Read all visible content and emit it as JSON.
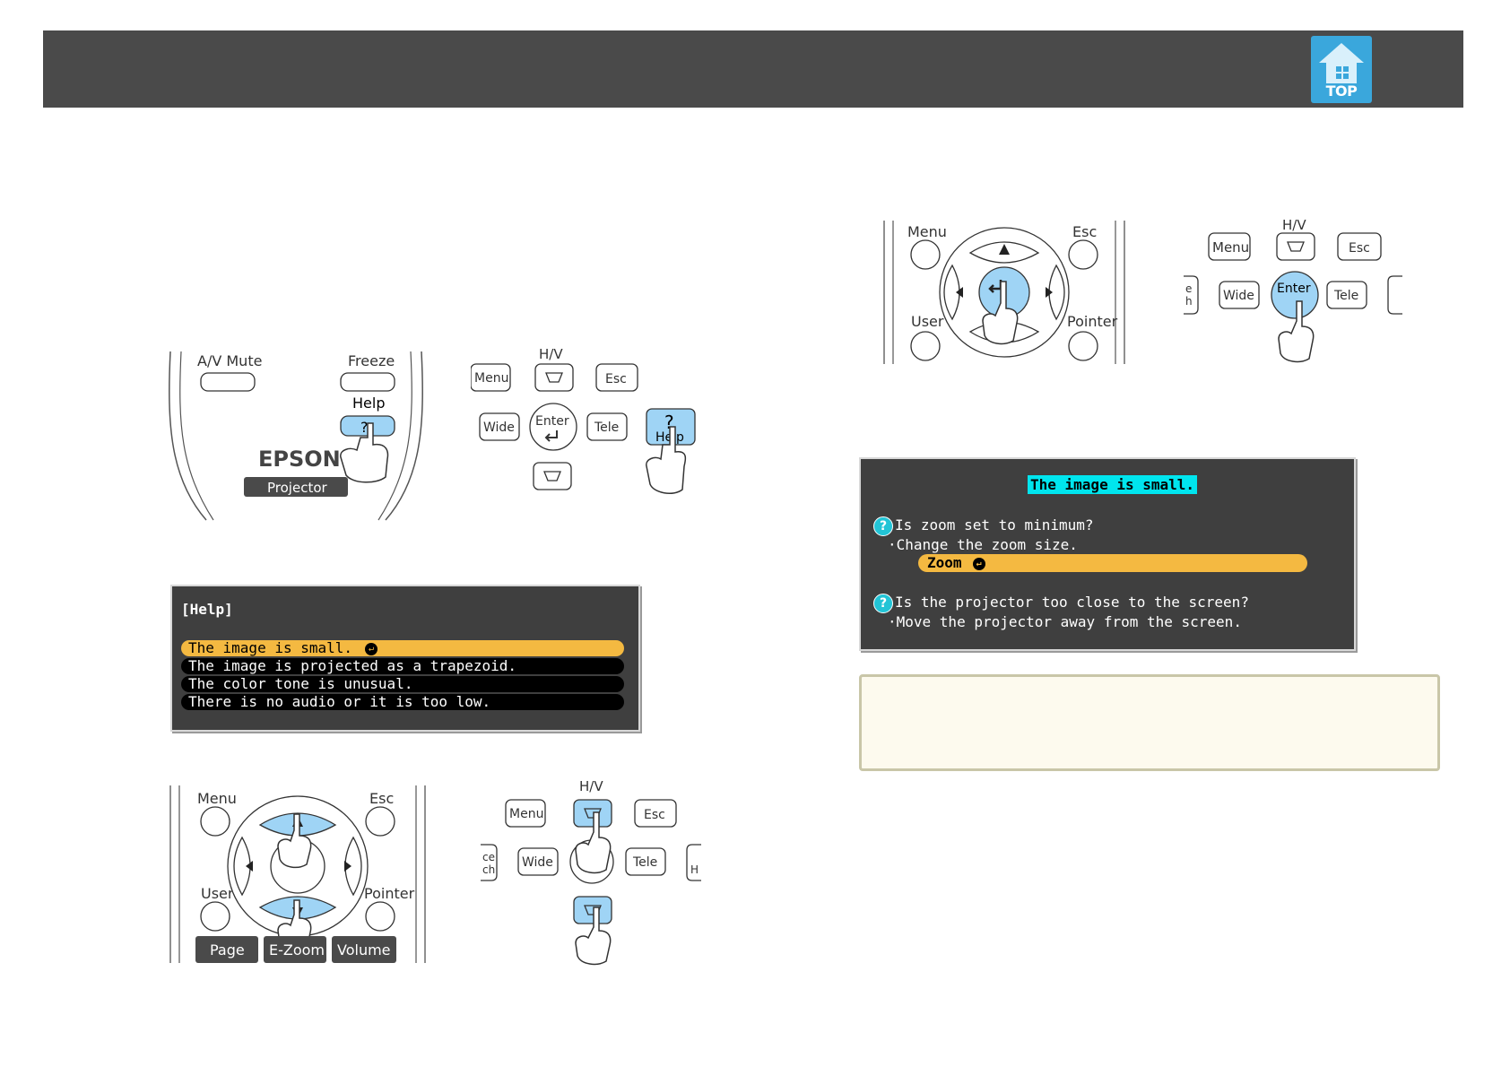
{
  "header": {
    "top_label": "TOP",
    "top_icon": "home-icon",
    "colors": {
      "bar": "#4a4a4a",
      "top_button": "#3aa7dc"
    }
  },
  "remote_help": {
    "av_mute": "A/V Mute",
    "freeze": "Freeze",
    "help": "Help",
    "help_symbol": "?",
    "brand": "EPSON",
    "projector": "Projector"
  },
  "panel_help": {
    "menu": "Menu",
    "hv": "H/V",
    "esc": "Esc",
    "wide": "Wide",
    "enter": "Enter",
    "tele": "Tele",
    "help": "Help",
    "help_symbol": "?"
  },
  "help_menu": {
    "title": "[Help]",
    "items": [
      "The image is small.",
      "The image is projected as a trapezoid.",
      "The color tone is unusual.",
      "There is no audio or it is too low."
    ],
    "selected_index": 0,
    "colors": {
      "selected": "#f4b941",
      "background": "#3f3f3f"
    }
  },
  "remote_nav": {
    "menu": "Menu",
    "esc": "Esc",
    "user": "User",
    "pointer": "Pointer",
    "page": "Page",
    "zoom": "E-Zoom",
    "volume": "Volume"
  },
  "panel_nav": {
    "menu": "Menu",
    "hv": "H/V",
    "esc": "Esc",
    "wide": "Wide",
    "tele": "Tele",
    "left_partial": "ce\nch",
    "right_partial": "H"
  },
  "remote_enter": {
    "menu": "Menu",
    "esc": "Esc",
    "user": "User",
    "pointer": "Pointer"
  },
  "panel_enter": {
    "menu": "Menu",
    "hv": "H/V",
    "esc": "Esc",
    "wide": "Wide",
    "enter": "Enter",
    "tele": "Tele"
  },
  "sub_screen": {
    "title": "The image is small.",
    "q1": "Is zoom set to minimum?",
    "a1": "·Change the zoom size.",
    "zoom_button": "Zoom",
    "q2": "Is the projector too close to the screen?",
    "a2": "·Move the projector away from the screen.",
    "q_symbol": "?",
    "colors": {
      "title_bg": "#00e5ee",
      "zoom_bg": "#f4b941",
      "icon": "#22c4d6"
    }
  }
}
